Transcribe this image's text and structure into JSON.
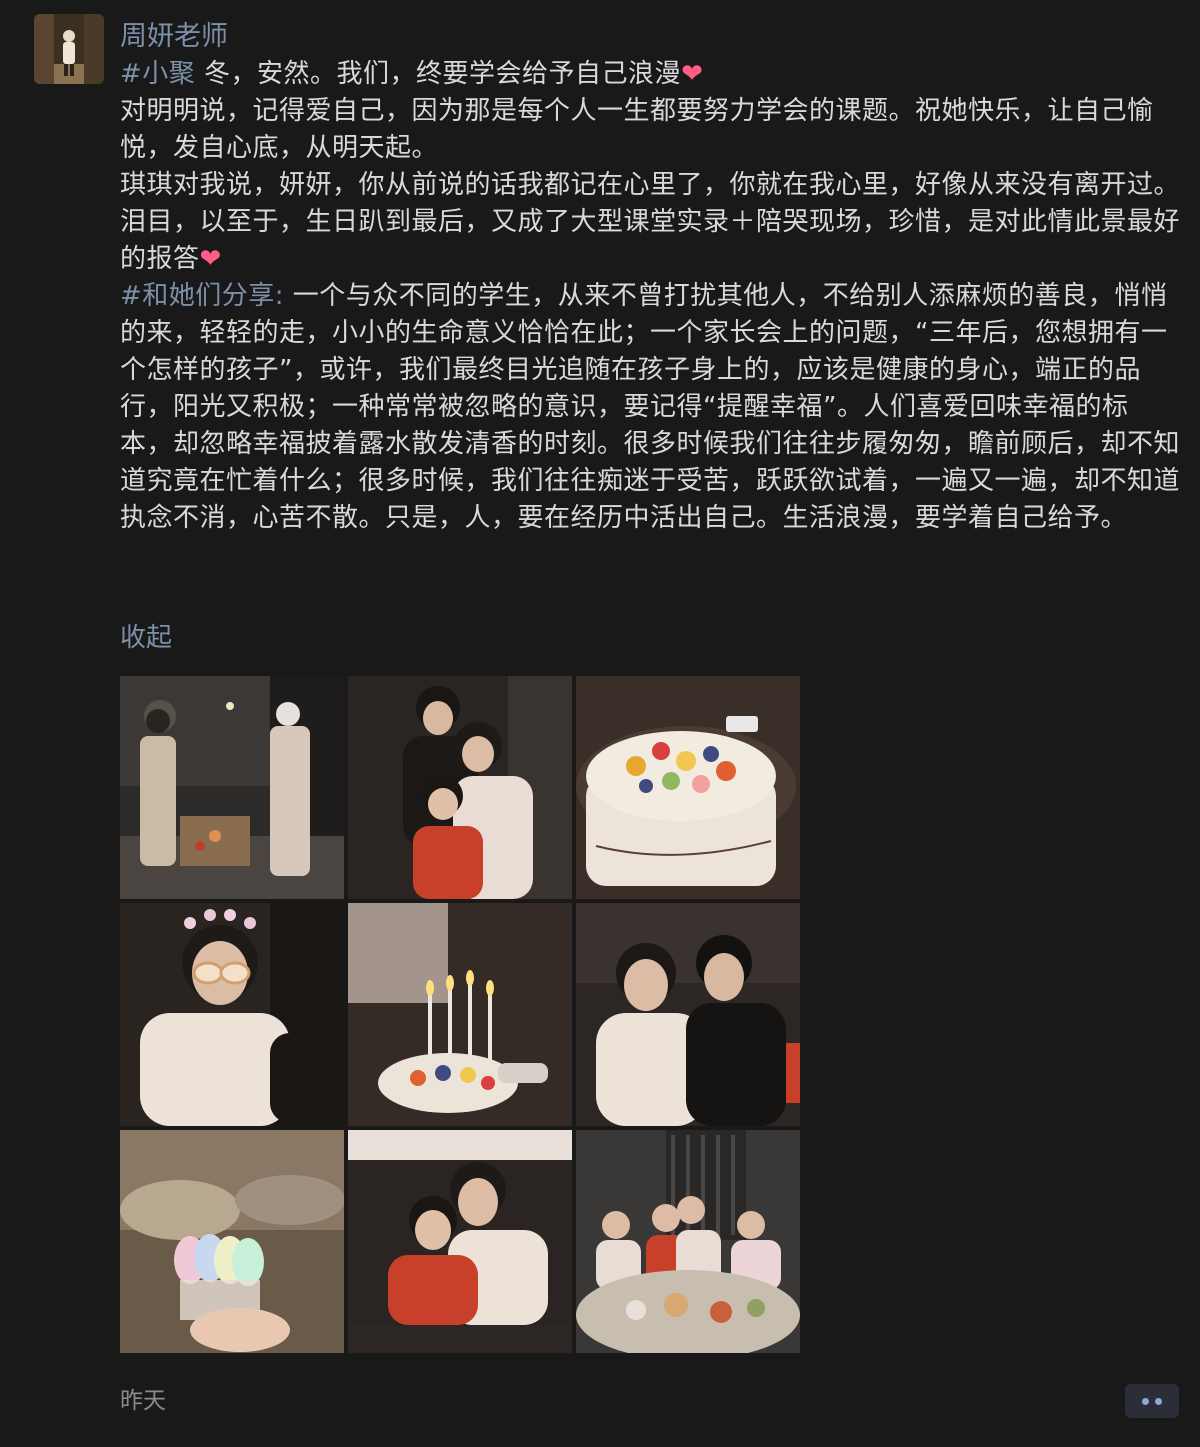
{
  "post": {
    "author": "周妍老师",
    "tag1": "#小聚",
    "line1": " 冬，安然。我们，终要学会给予自己浪漫",
    "para2": "对明明说，记得爱自己，因为那是每个人一生都要努力学会的课题。祝她快乐，让自己愉悦，发自心底，从明天起。",
    "para3": "琪琪对我说，妍妍，你从前说的话我都记在心里了，你就在我心里，好像从来没有离开过。泪目，以至于，生日趴到最后，又成了大型课堂实录＋陪哭现场，珍惜，是对此情此景最好的报答",
    "tag2": "#和她们分享:",
    "para4": " 一个与众不同的学生，从来不曾打扰其他人，不给别人添麻烦的善良，悄悄的来，轻轻的走，小小的生命意义恰恰在此；一个家长会上的问题，“三年后，您想拥有一个怎样的孩子”，或许，我们最终目光追随在孩子身上的，应该是健康的身心，端正的品行，阳光又积极；一种常常被忽略的意识，要记得“提醒幸福”。人们喜爱回味幸福的标本，却忽略幸福披着露水散发清香的时刻。很多时候我们往往步履匆匆，瞻前顾后，却不知道究竟在忙着什么；很多时候，我们往往痴迷于受苦，跃跃欲试着，一遍又一遍，却不知道执念不消，心苦不散。只是，人，要在经历中活出自己。生活浪漫，要学着自己给予。",
    "heart_icon": "❤",
    "collapse_label": "收起",
    "timestamp": "昨天"
  },
  "colors": {
    "background": "#191919",
    "link": "#7d90a9",
    "text": "#d9d9d9",
    "heart": "#ff5c86",
    "more_button_bg": "#2c2e37",
    "more_button_dots": "#8fa6d8"
  },
  "photos": [
    {
      "name": "photo-street-night",
      "icon": "image"
    },
    {
      "name": "photo-teachers-student",
      "icon": "image"
    },
    {
      "name": "photo-fruit-cake",
      "icon": "image"
    },
    {
      "name": "photo-birthday-glasses",
      "icon": "image"
    },
    {
      "name": "photo-cake-candles",
      "icon": "image"
    },
    {
      "name": "photo-two-women",
      "icon": "image"
    },
    {
      "name": "photo-plastic-spoons",
      "icon": "image"
    },
    {
      "name": "photo-teacher-girl",
      "icon": "image"
    },
    {
      "name": "photo-group-dinner",
      "icon": "image"
    }
  ],
  "icons": {
    "more": "more-dots-icon",
    "avatar": "avatar-image"
  }
}
